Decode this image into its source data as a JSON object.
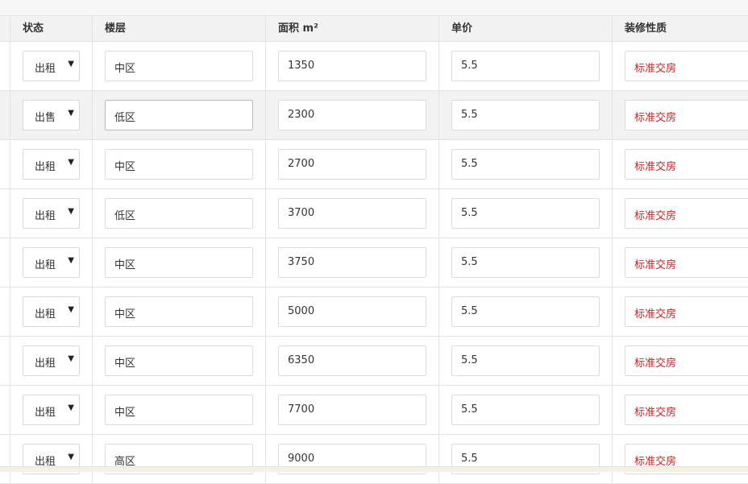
{
  "columns": {
    "status": "状态",
    "floor": "楼层",
    "area": "面积 m²",
    "price": "单价",
    "decoration": "装修性质"
  },
  "rows": [
    {
      "status": "出租",
      "floor": "中区",
      "area": "1350",
      "price": "5.5",
      "decoration": "标准交房"
    },
    {
      "status": "出售",
      "floor": "低区",
      "area": "2300",
      "price": "5.5",
      "decoration": "标准交房"
    },
    {
      "status": "出租",
      "floor": "中区",
      "area": "2700",
      "price": "5.5",
      "decoration": "标准交房"
    },
    {
      "status": "出租",
      "floor": "低区",
      "area": "3700",
      "price": "5.5",
      "decoration": "标准交房"
    },
    {
      "status": "出租",
      "floor": "中区",
      "area": "3750",
      "price": "5.5",
      "decoration": "标准交房"
    },
    {
      "status": "出租",
      "floor": "中区",
      "area": "5000",
      "price": "5.5",
      "decoration": "标准交房"
    },
    {
      "status": "出租",
      "floor": "中区",
      "area": "6350",
      "price": "5.5",
      "decoration": "标准交房"
    },
    {
      "status": "出租",
      "floor": "中区",
      "area": "7700",
      "price": "5.5",
      "decoration": "标准交房"
    },
    {
      "status": "出租",
      "floor": "高区",
      "area": "9000",
      "price": "5.5",
      "decoration": "标准交房"
    }
  ],
  "colors": {
    "decoration_text": "#d12323",
    "header_bg": "#f2f2f2",
    "highlight_row_bg": "#f2f2f2"
  },
  "icons": {
    "select_caret": "caret-down-icon"
  }
}
